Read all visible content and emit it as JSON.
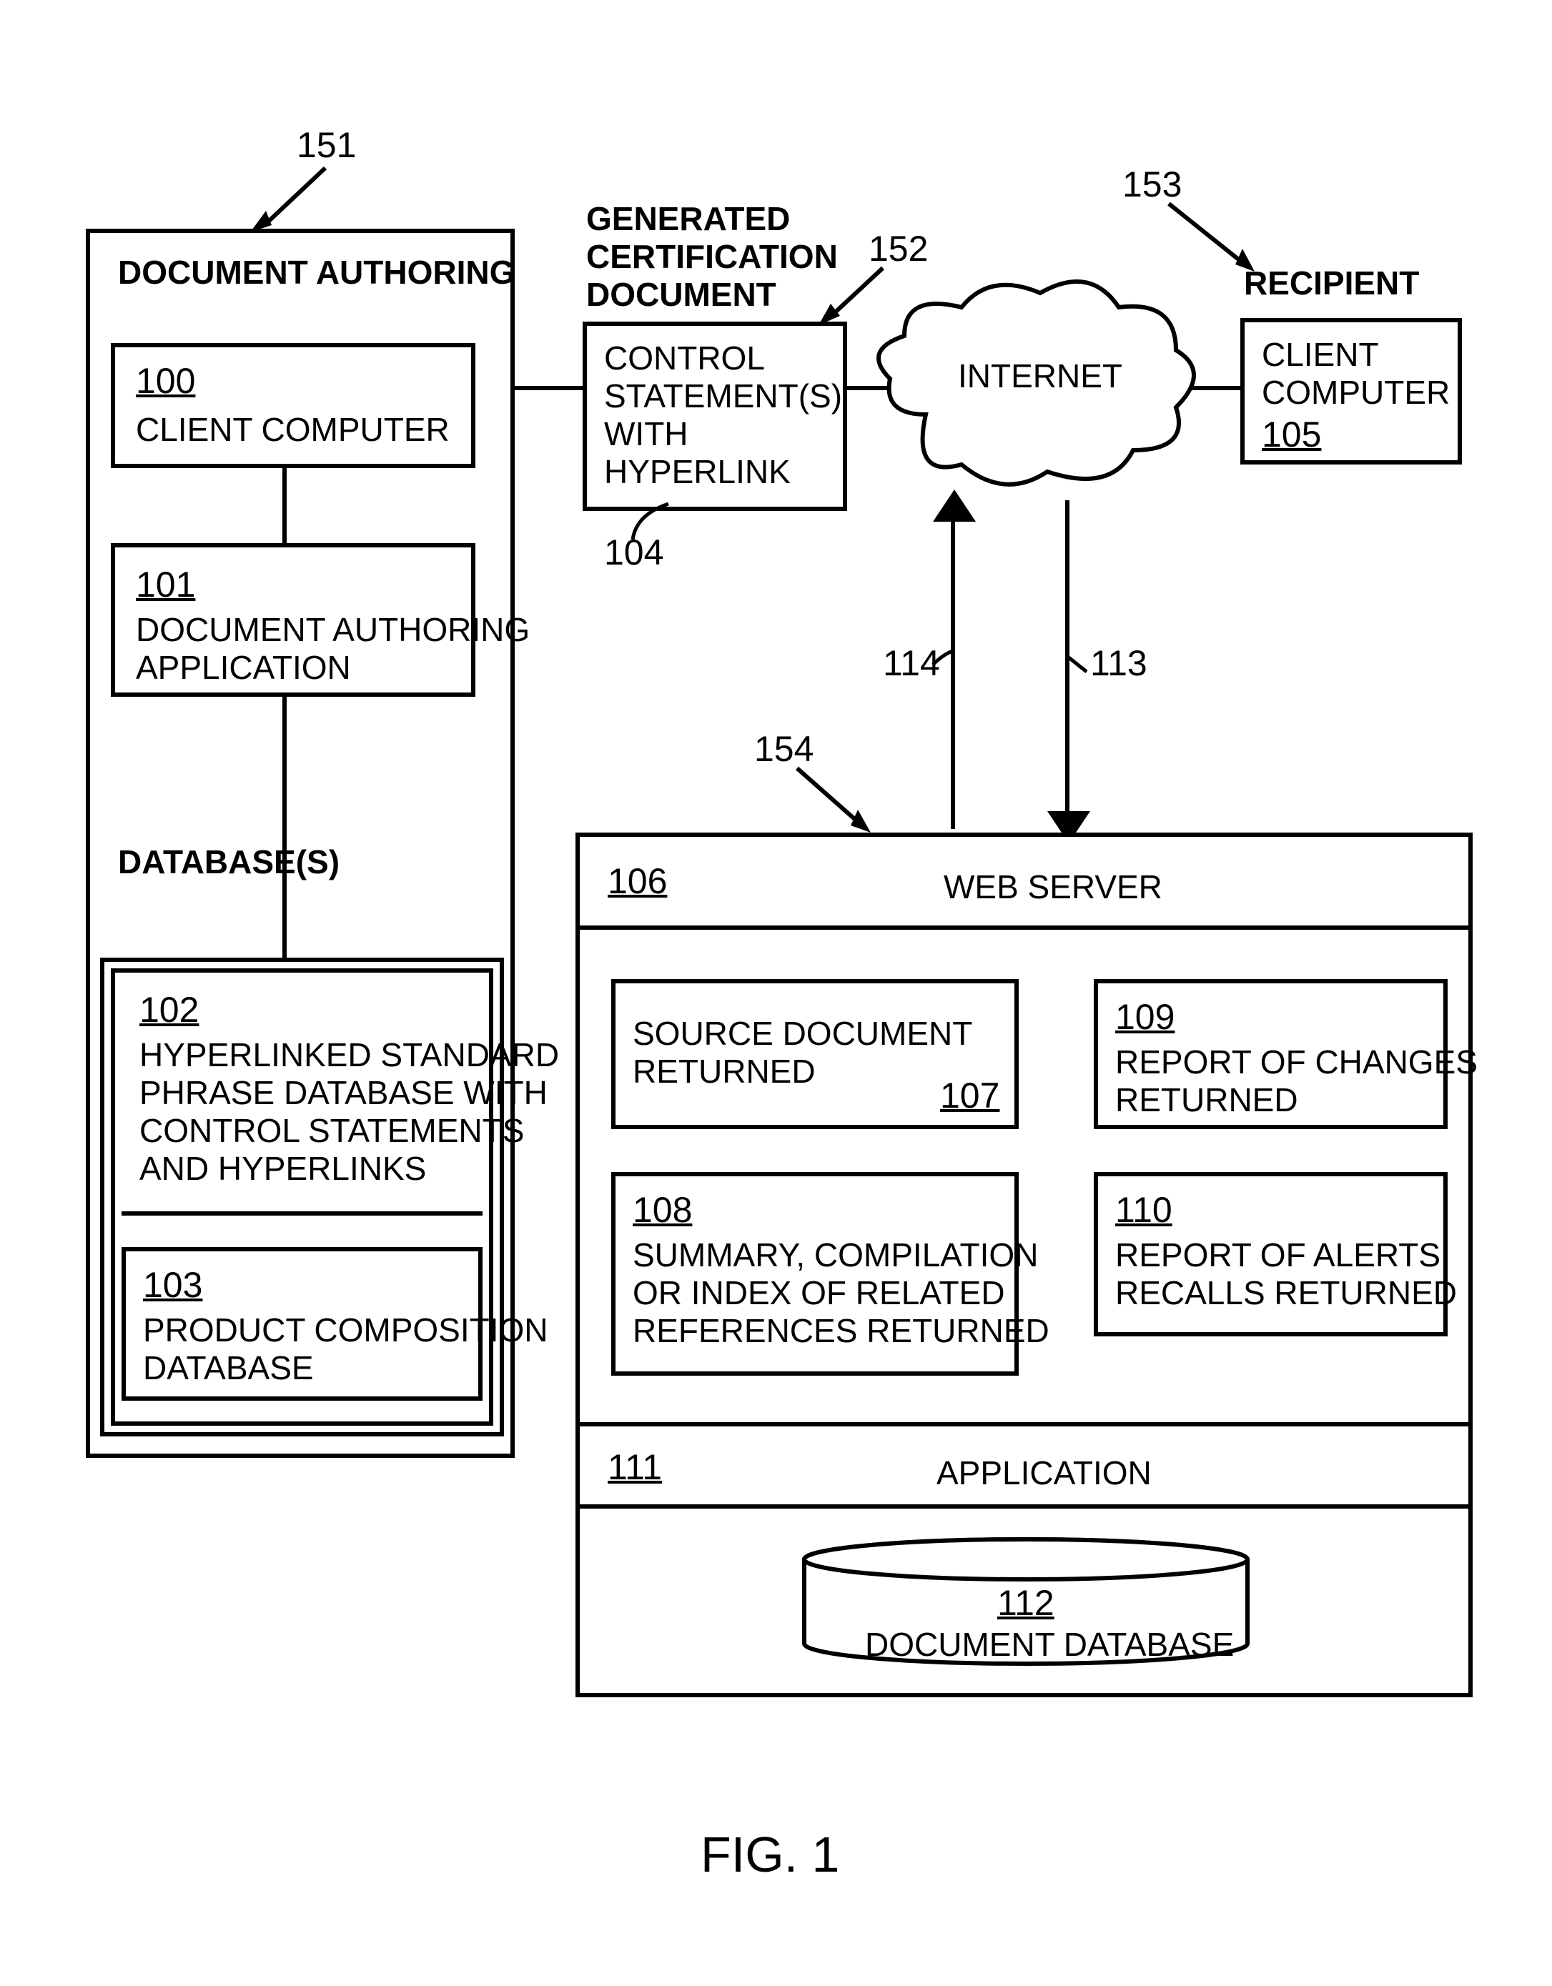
{
  "figLabel": "FIG. 1",
  "authoring": {
    "title": "DOCUMENT AUTHORING",
    "clientComputer": {
      "ref": "100",
      "label": "CLIENT COMPUTER"
    },
    "app": {
      "ref": "101",
      "label": "DOCUMENT AUTHORING\nAPPLICATION"
    },
    "dbHeader": "DATABASE(S)",
    "hyperDb": {
      "ref": "102",
      "label": "HYPERLINKED STANDARD\nPHRASE DATABASE WITH\nCONTROL STATEMENTS\nAND HYPERLINKS"
    },
    "prodDb": {
      "ref": "103",
      "label": "PRODUCT COMPOSITION\nDATABASE"
    }
  },
  "generated": {
    "title": "GENERATED\nCERTIFICATION\nDOCUMENT",
    "ref": "104",
    "label": "CONTROL\nSTATEMENT(S)\nWITH\nHYPERLINK"
  },
  "internet": "INTERNET",
  "recipient": {
    "title": "RECIPIENT",
    "ref": "105",
    "label": "CLIENT\nCOMPUTER"
  },
  "server": {
    "ref": "106",
    "title": "WEB SERVER",
    "srcDoc": {
      "ref": "107",
      "label": "SOURCE DOCUMENT\nRETURNED"
    },
    "summary": {
      "ref": "108",
      "label": "SUMMARY, COMPILATION\nOR INDEX OF RELATED\nREFERENCES RETURNED"
    },
    "changes": {
      "ref": "109",
      "label": "REPORT OF CHANGES\nRETURNED"
    },
    "alerts": {
      "ref": "110",
      "label": "REPORT OF ALERTS,\nRECALLS RETURNED"
    },
    "appRef": "111",
    "appLabel": "APPLICATION",
    "dbRef": "112",
    "dbLabel": "DOCUMENT DATABASE"
  },
  "callouts": {
    "c151": "151",
    "c152": "152",
    "c153": "153",
    "c154": "154",
    "c113": "113",
    "c114": "114"
  }
}
